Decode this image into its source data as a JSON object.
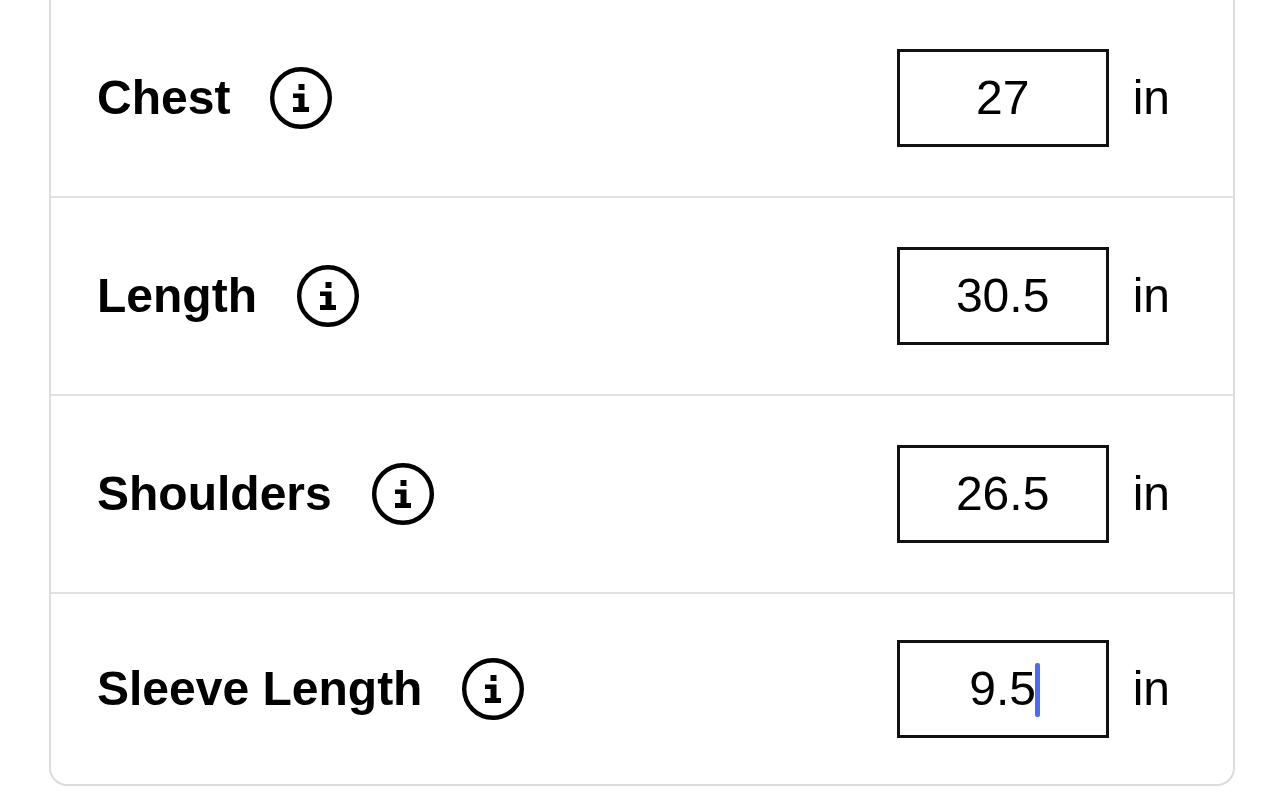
{
  "measurements": [
    {
      "label": "Chest",
      "value": "27",
      "unit": "in",
      "focused": false
    },
    {
      "label": "Length",
      "value": "30.5",
      "unit": "in",
      "focused": false
    },
    {
      "label": "Shoulders",
      "value": "26.5",
      "unit": "in",
      "focused": false
    },
    {
      "label": "Sleeve Length",
      "value": "9.5",
      "unit": "in",
      "focused": true
    }
  ]
}
